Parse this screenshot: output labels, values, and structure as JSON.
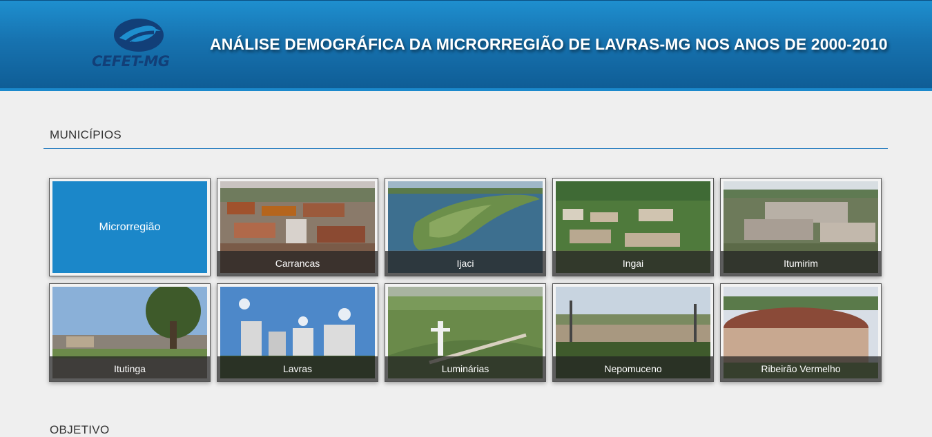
{
  "header": {
    "logo_text": "CEFET-MG",
    "title": "ANÁLISE DEMOGRÁFICA DA MICRORREGIÃO DE LAVRAS-MG NOS ANOS DE 2000-2010"
  },
  "sections": {
    "municipios": "MUNICÍPIOS",
    "objetivo": "OBJETIVO"
  },
  "colors": {
    "header_blue": "#1773b0",
    "accent": "#1b87c9"
  },
  "cards": [
    {
      "label": "Microrregião",
      "icon": "primary-tile"
    },
    {
      "label": "Carrancas",
      "icon": "aerial-town-photo"
    },
    {
      "label": "Ijaci",
      "icon": "lake-peninsula-photo"
    },
    {
      "label": "Ingai",
      "icon": "aerial-village-photo"
    },
    {
      "label": "Itumirim",
      "icon": "aerial-town-photo"
    },
    {
      "label": "Itutinga",
      "icon": "town-square-photo"
    },
    {
      "label": "Lavras",
      "icon": "city-buildings-photo"
    },
    {
      "label": "Luminárias",
      "icon": "statue-hill-photo"
    },
    {
      "label": "Nepomuceno",
      "icon": "palm-town-photo"
    },
    {
      "label": "Ribeirão Vermelho",
      "icon": "roundhouse-photo"
    }
  ]
}
